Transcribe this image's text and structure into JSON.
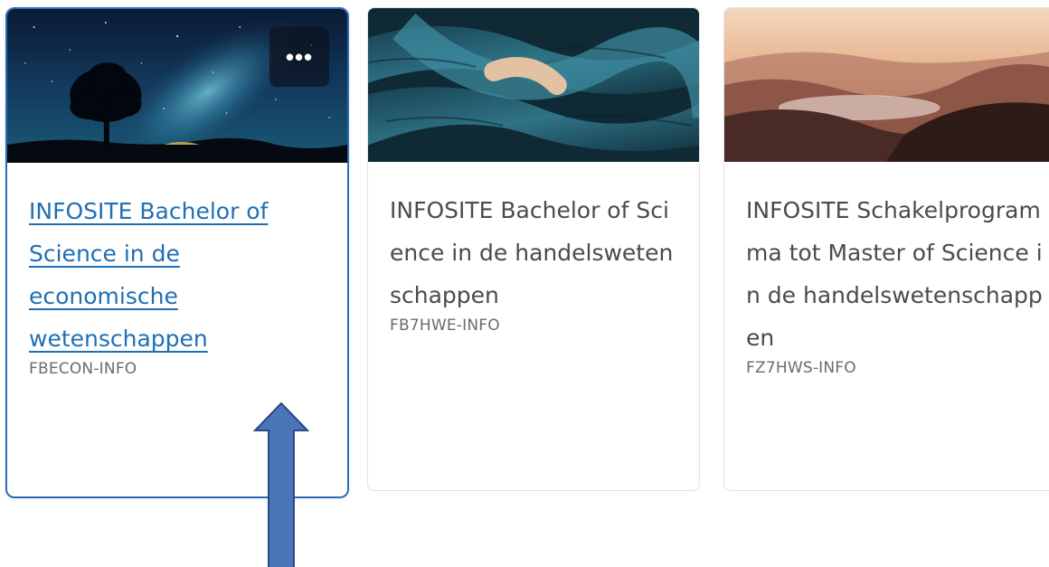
{
  "cards": [
    {
      "title": "INFOSITE Bachelor of Science in de economische wetenschappen",
      "code": "FBECON-INFO",
      "image": "night-sky-milky-way-tree",
      "selected": true,
      "more_label": "•••"
    },
    {
      "title": "INFOSITE Bachelor of Science in de handelswetenschappen",
      "code": "FB7HWE-INFO",
      "image": "teal-rope-closeup",
      "selected": false
    },
    {
      "title": "INFOSITE Schakelprogramma tot Master of Science in de handelswetenschappen",
      "code": "FZ7HWS-INFO",
      "image": "sunset-mountain-valley",
      "selected": false
    }
  ],
  "colors": {
    "link": "#1f6fb5",
    "selected_border": "#2a6db5",
    "title_text": "#4b4b4b",
    "code_text": "#6b6b6b",
    "arrow_fill": "#4a75b9",
    "arrow_stroke": "#2b4a80"
  },
  "annotation": {
    "icon": "up-arrow-icon",
    "points_to": "card-1"
  }
}
